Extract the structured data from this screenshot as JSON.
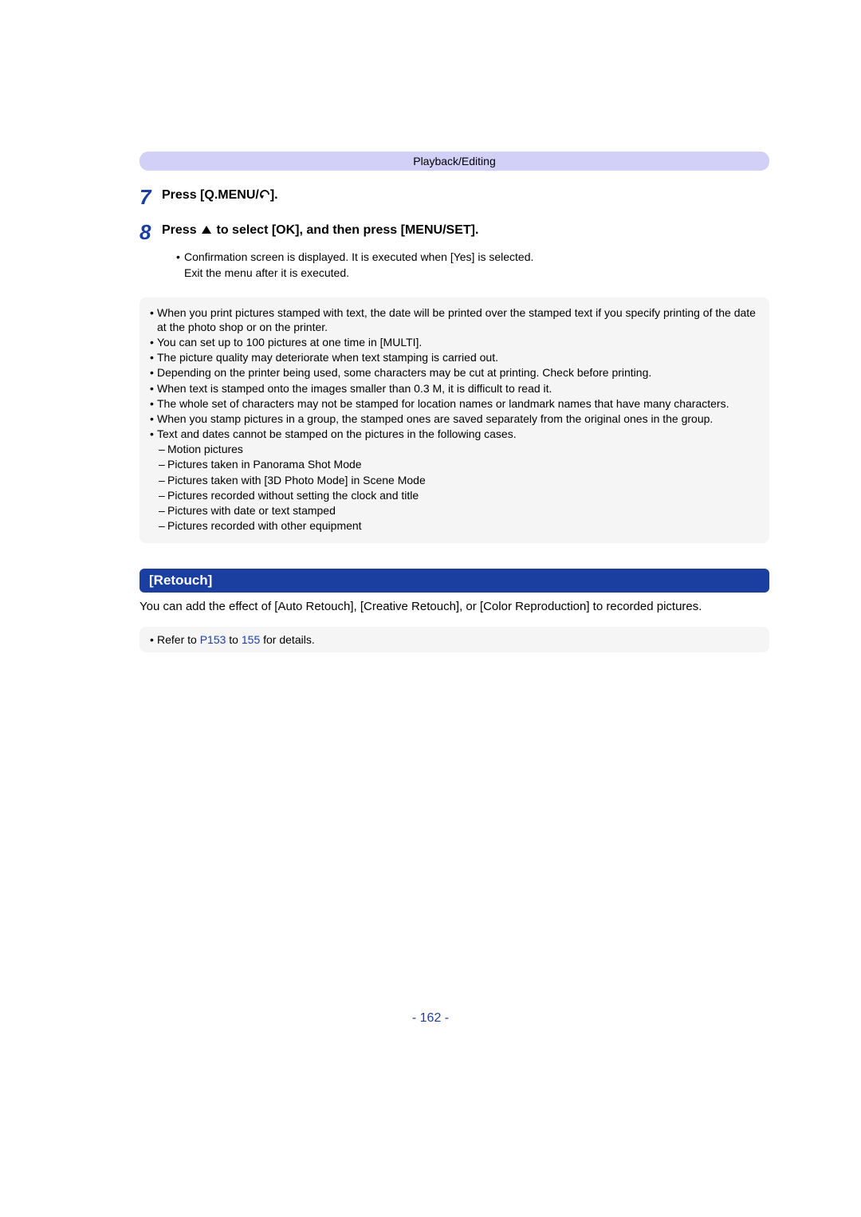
{
  "header": "Playback/Editing",
  "steps": [
    {
      "num": "7",
      "title_pre": "Press [Q.MENU/",
      "title_post": "].",
      "sub": []
    },
    {
      "num": "8",
      "title_pre": "Press ",
      "title_post": " to select [OK], and then press [MENU/SET].",
      "sub_line1": "Confirmation screen is displayed. It is executed when [Yes] is selected.",
      "sub_line2": "Exit the menu after it is executed."
    }
  ],
  "info": [
    "When you print pictures stamped with text, the date will be printed over the stamped text if you specify printing of the date at the photo shop or on the printer.",
    "You can set up to 100 pictures at one time in [MULTI].",
    "The picture quality may deteriorate when text stamping is carried out.",
    "Depending on the printer being used, some characters may be cut at printing. Check before printing.",
    "When text is stamped onto the images smaller than 0.3 M, it is difficult to read it.",
    "The whole set of characters may not be stamped for location names or landmark names that have many characters.",
    "When you stamp pictures in a group, the stamped ones are saved separately from the original ones in the group.",
    "Text and dates cannot be stamped on the pictures in the following cases."
  ],
  "info_sub": [
    "Motion pictures",
    "Pictures taken in Panorama Shot Mode",
    "Pictures taken with [3D Photo Mode] in Scene Mode",
    "Pictures recorded without setting the clock and title",
    "Pictures with date or text stamped",
    "Pictures recorded with other equipment"
  ],
  "section_title": "[Retouch]",
  "section_desc": "You can add the effect of [Auto Retouch], [Creative Retouch], or [Color Reproduction] to recorded pictures.",
  "refer_pre": "Refer to ",
  "refer_link1": "P153",
  "refer_mid": " to ",
  "refer_link2": "155",
  "refer_post": " for details.",
  "page_num": "- 162 -"
}
